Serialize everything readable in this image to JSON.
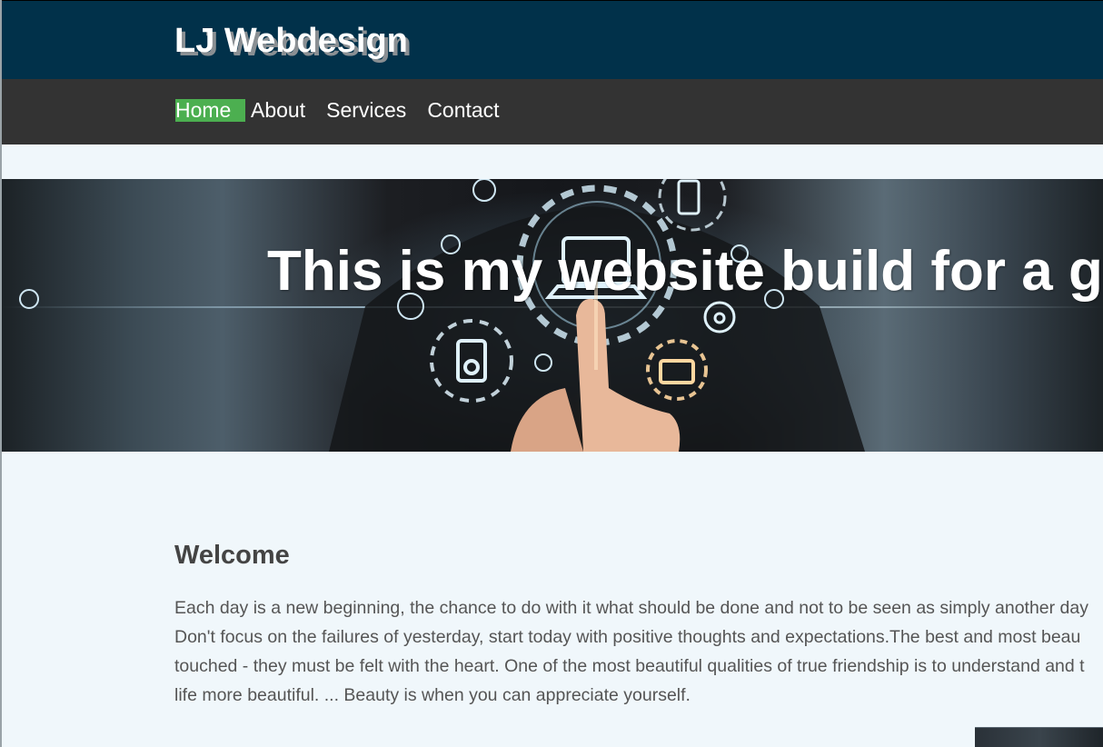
{
  "header": {
    "brand": "LJ Webdesign"
  },
  "nav": {
    "items": [
      {
        "label": "Home",
        "active": true
      },
      {
        "label": "About",
        "active": false
      },
      {
        "label": "Services",
        "active": false
      },
      {
        "label": "Contact",
        "active": false
      }
    ]
  },
  "hero": {
    "title": "This is my website build for a g"
  },
  "main": {
    "heading": "Welcome",
    "paragraph_lines": [
      "Each day is a new beginning, the chance to do with it what should be done and not to be seen as simply another day",
      "Don't focus on the failures of yesterday, start today with positive thoughts and expectations.The best and most beau",
      "touched - they must be felt with the heart. One of the most beautiful qualities of true friendship is to understand and t",
      "life more beautiful. ... Beauty is when you can appreciate yourself."
    ]
  },
  "colors": {
    "header_bg": "#01314a",
    "nav_bg": "#333333",
    "nav_active": "#4caf50",
    "page_bg": "#f0f7fb",
    "text": "#555555"
  }
}
